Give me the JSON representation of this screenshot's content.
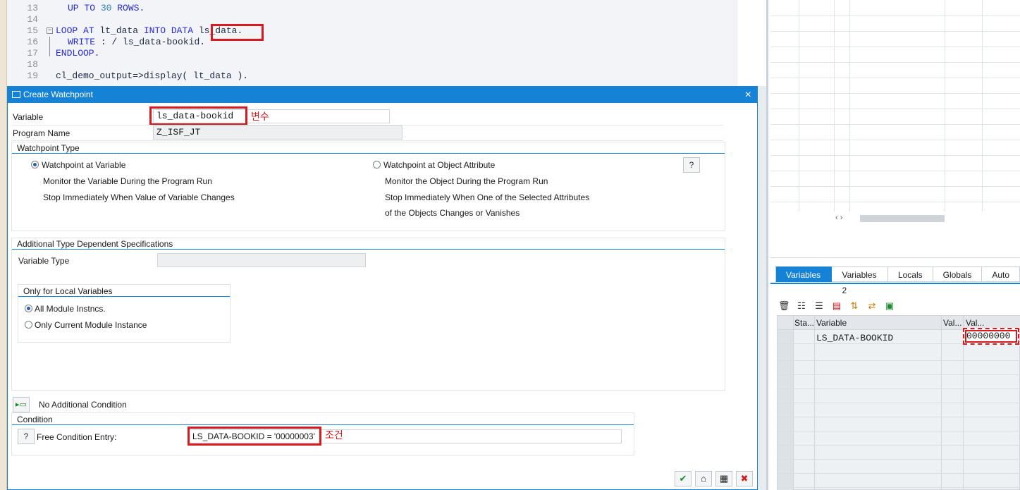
{
  "code": {
    "lines": [
      {
        "num": "13",
        "text_kw1": "UP TO",
        "text_num": "30",
        "text_kw2": "ROWS."
      },
      {
        "num": "14"
      },
      {
        "num": "15",
        "kw1": "LOOP AT",
        "t1": " lt_data ",
        "kw2": "INTO DATA",
        "t2": " ",
        "hl": "ls_data",
        "t3": "."
      },
      {
        "num": "16",
        "kw1": "WRITE",
        "t1": " : / ls_data-bookid."
      },
      {
        "num": "17",
        "kw1": "ENDLOOP."
      },
      {
        "num": "18"
      },
      {
        "num": "19",
        "t1": "cl_demo_output=>display( lt_data )."
      }
    ]
  },
  "dialog": {
    "title": "Create Watchpoint",
    "close_icon": "×",
    "variable_label": "Variable",
    "variable_value": "ls_data-bookid",
    "variable_note": "변수",
    "program_label": "Program Name",
    "program_value": "Z_ISF_JT",
    "wp_type_title": "Watchpoint Type",
    "wp_var": {
      "label": "Watchpoint at Variable",
      "desc1": "Monitor the Variable During the Program Run",
      "desc2": "Stop Immediately When Value of Variable Changes"
    },
    "wp_obj": {
      "label": "Watchpoint at Object Attribute",
      "desc1": "Monitor the Object During the Program Run",
      "desc2": "Stop Immediately When One of the Selected Attributes",
      "desc3": "of the Objects Changes or Vanishes"
    },
    "additional_title": "Additional Type Dependent Specifications",
    "variable_type_label": "Variable Type",
    "local_title": "Only for Local Variables",
    "local_opt1": "All Module Instncs.",
    "local_opt2": "Only Current Module Instance",
    "no_condition_label": "No Additional Condition",
    "condition_title": "Condition",
    "free_condition_label": "Free Condition Entry:",
    "condition_value": "LS_DATA-BOOKID = '00000003'",
    "condition_note": "조건"
  },
  "right": {
    "tabs": [
      "Variables 1",
      "Variables 2",
      "Locals",
      "Globals",
      "Auto"
    ],
    "table": {
      "headers": [
        "Sta...",
        "Variable",
        "Val...",
        "Val..."
      ],
      "row": {
        "variable": "LS_DATA-BOOKID",
        "value": "00000000"
      }
    }
  },
  "icons": {
    "help": "help-icon",
    "condition": "condition-icon",
    "ok": "check-icon",
    "cancel": "cancel-icon"
  }
}
